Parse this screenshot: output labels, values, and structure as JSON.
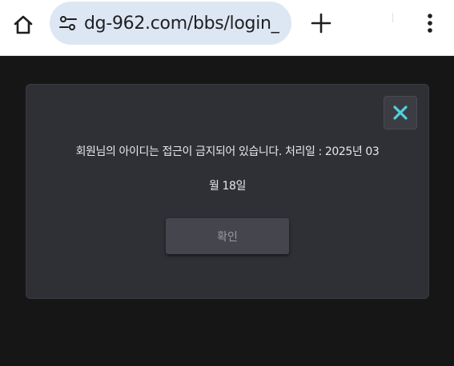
{
  "browser": {
    "url": "dg-962.com/bbs/login_",
    "icons": {
      "home": "home-icon",
      "site_settings": "tune-icon",
      "new_tab": "plus-icon",
      "menu": "more-vert-icon"
    }
  },
  "dialog": {
    "message_line1": "회원님의 아이디는 접근이 금지되어 있습니다. 처리일 : 2025년 03",
    "message_line2": "월 18일",
    "confirm_label": "확인",
    "close_icon": "close-icon"
  },
  "colors": {
    "page_background": "#161616",
    "dialog_background": "#2f3035",
    "close_x": "#4fd1e0",
    "url_pill": "#dde7f3"
  }
}
